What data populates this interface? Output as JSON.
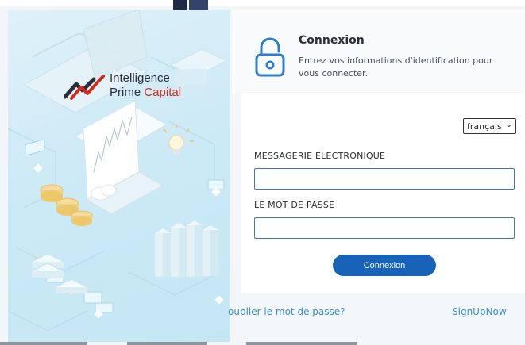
{
  "brand": {
    "line1": "Intelligence",
    "line2_part1": "Prime ",
    "line2_part2": "Capital",
    "accent": "#d32a1c"
  },
  "login": {
    "title": "Connexion",
    "subtitle": "Entrez vos informations d'identification pour vous connecter.",
    "language": {
      "selected": "français"
    },
    "email_label": "MESSAGERIE ÉLECTRONIQUE",
    "email_value": "",
    "password_label": "LE MOT DE PASSE",
    "password_value": "",
    "submit_label": "Connexion",
    "forgot_link": "oublier le mot de passe?",
    "signup_link": "SignUpNow"
  },
  "colors": {
    "primary_button": "#1863b8",
    "link": "#3a8fd0",
    "field_border": "#3b78c2"
  },
  "icons": {
    "lock": "lock-icon",
    "dropdown": "chevron-down-icon"
  }
}
